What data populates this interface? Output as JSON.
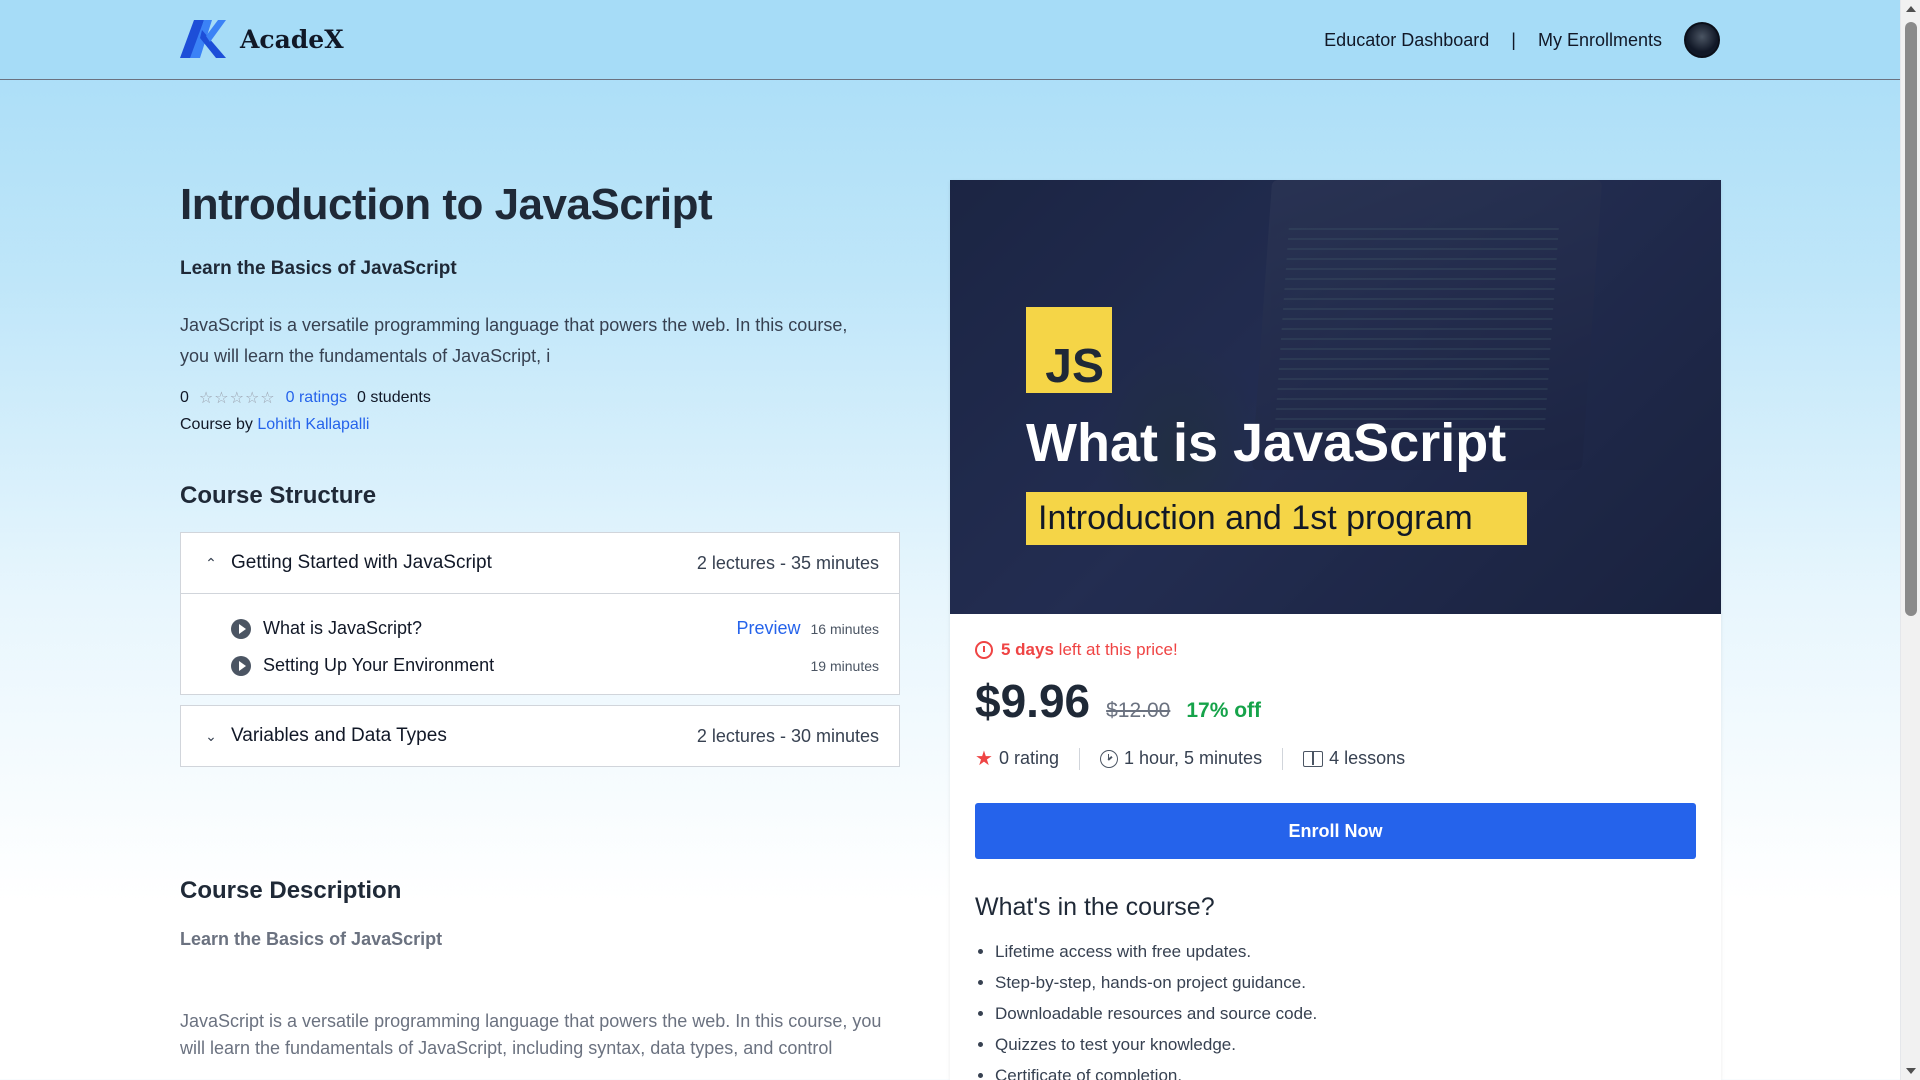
{
  "header": {
    "brand": "AcadeX",
    "nav": {
      "educator_dashboard": "Educator Dashboard",
      "separator": "|",
      "my_enrollments": "My Enrollments"
    }
  },
  "course": {
    "title": "Introduction to JavaScript",
    "subtitle": "Learn the Basics of JavaScript",
    "summary": "JavaScript is a versatile programming language that powers the web. In this course, you will learn the fundamentals of JavaScript, i",
    "rating_value": "0",
    "stars": "☆☆☆☆☆",
    "ratings_link": "0 ratings",
    "students": "0 students",
    "author_prefix": "Course by",
    "author": "Lohith Kallapalli"
  },
  "structure": {
    "heading": "Course Structure",
    "chapters": [
      {
        "title": "Getting Started with JavaScript",
        "meta": "2 lectures - 35 minutes",
        "expanded": true,
        "lectures": [
          {
            "title": "What is JavaScript?",
            "preview": "Preview",
            "duration": "16 minutes"
          },
          {
            "title": "Setting Up Your Environment",
            "preview": "",
            "duration": "19 minutes"
          }
        ]
      },
      {
        "title": "Variables and Data Types",
        "meta": "2 lectures - 30 minutes",
        "expanded": false
      }
    ]
  },
  "description": {
    "heading": "Course Description",
    "subheading": "Learn the Basics of JavaScript",
    "body": "JavaScript is a versatile programming language that powers the web. In this course, you will learn the fundamentals of JavaScript, including syntax, data types, and control"
  },
  "card": {
    "thumbnail": {
      "badge": "JS",
      "title": "What is JavaScript",
      "subtitle": "Introduction and 1st program"
    },
    "countdown_bold": "5 days",
    "countdown_rest": " left at this price!",
    "price": "$9.96",
    "original_price": "$12.00",
    "discount": "17% off",
    "rating": "0 rating",
    "duration": "1 hour, 5 minutes",
    "lessons": "4 lessons",
    "enroll_label": "Enroll Now",
    "included_heading": "What's in the course?",
    "included": [
      "Lifetime access with free updates.",
      "Step-by-step, hands-on project guidance.",
      "Downloadable resources and source code.",
      "Quizzes to test your knowledge.",
      "Certificate of completion."
    ]
  },
  "colors": {
    "accent": "#2563eb",
    "header_bg": "#a6dcf7",
    "countdown": "#ef4444",
    "discount": "#16a34a",
    "js_yellow": "#f5d547"
  },
  "icons": [
    "logo-mark-icon",
    "chevron-up-icon",
    "chevron-down-icon",
    "play-icon",
    "timer-icon",
    "star-icon",
    "clock-icon",
    "book-icon"
  ]
}
